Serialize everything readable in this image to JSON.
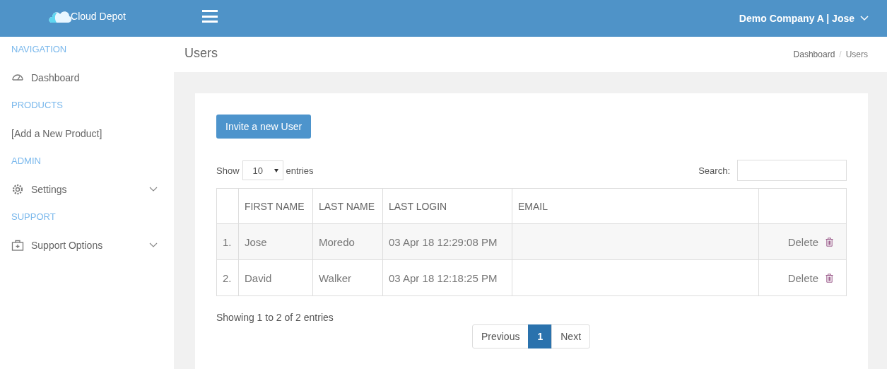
{
  "header": {
    "brand": "Cloud Depot",
    "account": "Demo Company A | Jose"
  },
  "sidebar": {
    "items": [
      {
        "kind": "heading",
        "label": "NAVIGATION"
      },
      {
        "kind": "gauge",
        "label": "Dashboard",
        "expandable": false
      },
      {
        "kind": "heading",
        "label": "PRODUCTS"
      },
      {
        "kind": "plain",
        "label": "[Add a New Product]",
        "expandable": false
      },
      {
        "kind": "heading",
        "label": "ADMIN"
      },
      {
        "kind": "gear",
        "label": "Settings",
        "expandable": true
      },
      {
        "kind": "heading",
        "label": "SUPPORT"
      },
      {
        "kind": "kit",
        "label": "Support Options",
        "expandable": true
      }
    ]
  },
  "page": {
    "title": "Users",
    "breadcrumb": [
      "Dashboard",
      "Users"
    ],
    "breadcrumb_separator": "/"
  },
  "invite_button": "Invite a new User",
  "length_control": {
    "before": "Show",
    "value": "10",
    "after": "entries"
  },
  "search": {
    "label": "Search:"
  },
  "table": {
    "columns": [
      "",
      "FIRST NAME",
      "LAST NAME",
      "LAST LOGIN",
      "EMAIL",
      ""
    ],
    "rows": [
      {
        "cells": [
          "1.",
          "Jose",
          "Moredo",
          "03 Apr 18 12:29:08 PM",
          ""
        ],
        "action": "Delete"
      },
      {
        "cells": [
          "2.",
          "David",
          "Walker",
          "03 Apr 18 12:18:25 PM",
          ""
        ],
        "action": "Delete"
      }
    ]
  },
  "info": "Showing 1 to 2 of 2 entries",
  "pagination": {
    "previous": "Previous",
    "pages": [
      {
        "label": "1",
        "selected": true
      }
    ],
    "next": "Next"
  }
}
